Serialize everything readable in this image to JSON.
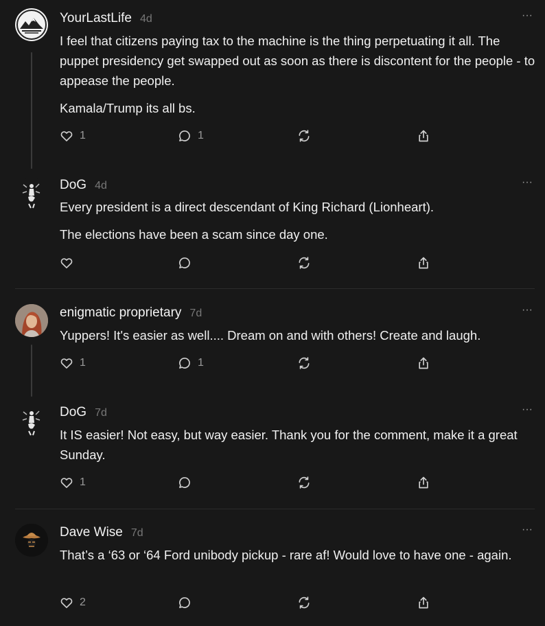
{
  "comments": [
    {
      "author": "YourLastLife",
      "time": "4d",
      "more": "···",
      "paragraphs": [
        "I feel that citizens paying tax to the machine is the thing perpetuating it all. The puppet presidency get swapped out as soon as there is discontent for the people - to appease the people.",
        "Kamala/Trump its all bs."
      ],
      "likes": "1",
      "replies": "1"
    },
    {
      "author": "DoG",
      "time": "4d",
      "more": "···",
      "paragraphs": [
        "Every president is a direct descendant of King Richard (Lionheart).",
        "The elections have been a scam since day one."
      ],
      "likes": "",
      "replies": ""
    },
    {
      "author": "enigmatic proprietary",
      "time": "7d",
      "more": "···",
      "paragraphs": [
        "Yuppers! It's easier as well.... Dream on and with others! Create and laugh."
      ],
      "likes": "1",
      "replies": "1"
    },
    {
      "author": "DoG",
      "time": "7d",
      "more": "···",
      "paragraphs": [
        "It IS easier! Not easy, but way easier. Thank you for the comment, make it a great Sunday."
      ],
      "likes": "1",
      "replies": ""
    },
    {
      "author": "Dave Wise",
      "time": "7d",
      "more": "···",
      "paragraphs": [
        "That’s a ‘63 or ‘64 Ford unibody pickup - rare af! Would love to have one - again."
      ],
      "likes": "2",
      "replies": ""
    }
  ],
  "icons": {
    "like": "heart-icon",
    "reply": "comment-bubble-icon",
    "restack": "restack-icon",
    "share": "share-icon"
  },
  "colors": {
    "background": "#181818",
    "text": "#f3f3f3",
    "muted": "#9a9a9a"
  }
}
